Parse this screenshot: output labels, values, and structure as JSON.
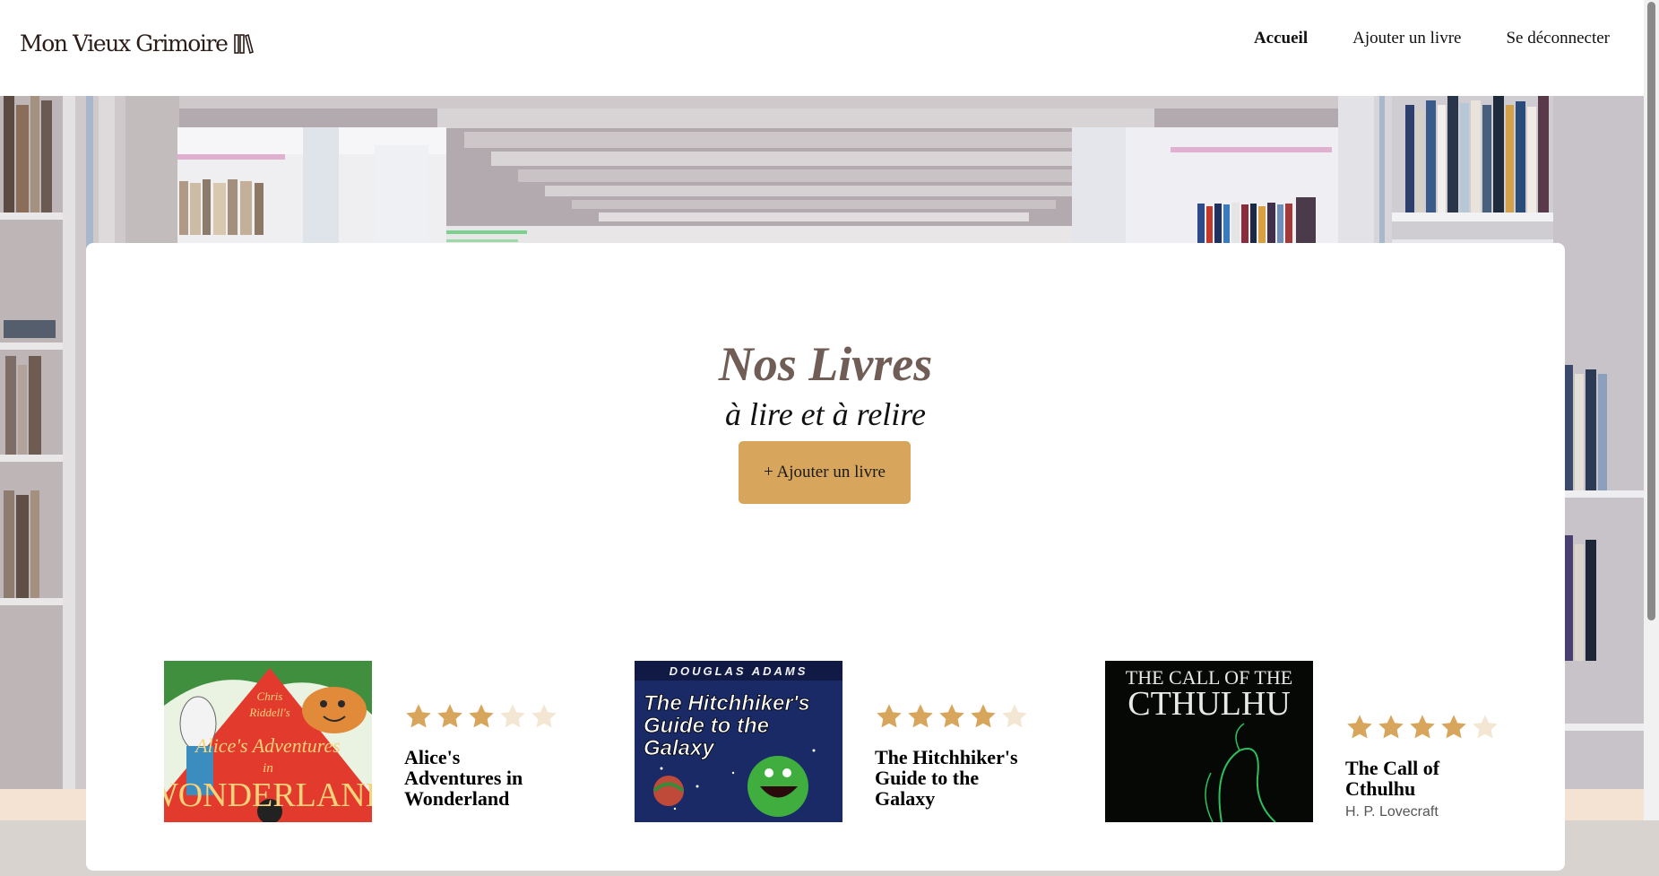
{
  "header": {
    "logo_text": "Mon Vieux Grimoire",
    "nav": [
      {
        "label": "Accueil",
        "active": true
      },
      {
        "label": "Ajouter un livre",
        "active": false
      },
      {
        "label": "Se déconnecter",
        "active": false
      }
    ]
  },
  "main": {
    "title": "Nos Livres",
    "subtitle": "à lire et à relire",
    "add_button": "+ Ajouter un livre"
  },
  "books": [
    {
      "title": "Alice's Adventures in Wonderland",
      "rating": 3,
      "author": "",
      "cover_lines": [
        "Chris",
        "Riddell's",
        "Alice's Adventures",
        "in",
        "WONDERLAND"
      ]
    },
    {
      "title": "The Hitchhiker's Guide to the Galaxy",
      "rating": 4,
      "author": "",
      "cover_lines": [
        "DOUGLAS ADAMS",
        "The Hitchhiker's",
        "Guide to the",
        "Galaxy"
      ]
    },
    {
      "title": "The Call of Cthulhu",
      "rating": 4,
      "author": "H. P. Lovecraft",
      "cover_lines": [
        "THE CALL OF THE",
        "CTHULHU"
      ]
    }
  ],
  "colors": {
    "accent": "#d7a65c",
    "star_filled": "#d7a65c",
    "star_empty": "#f3e6d3",
    "title": "#6f5d56"
  }
}
